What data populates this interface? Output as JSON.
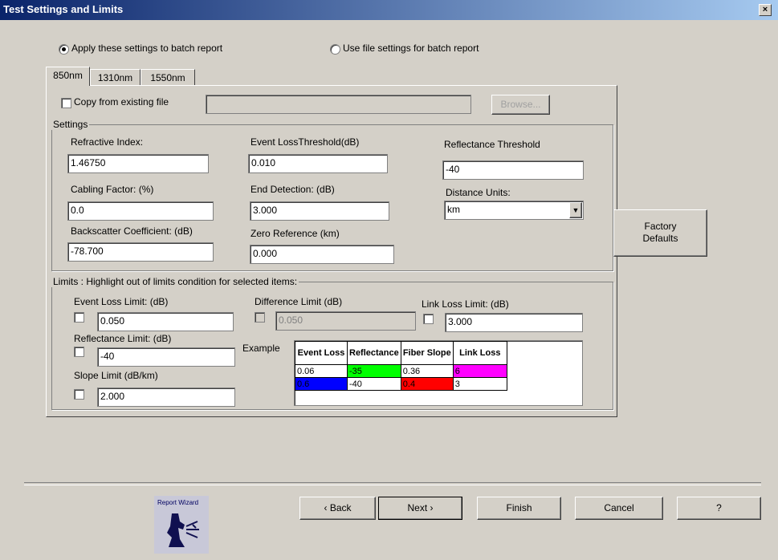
{
  "window": {
    "title": "Test Settings and Limits",
    "close_label": "×"
  },
  "batch": {
    "apply_label": "Apply these settings to batch report",
    "use_file_label": "Use file settings for batch report",
    "selected": "apply"
  },
  "tabs": [
    {
      "label": "850nm"
    },
    {
      "label": "1310nm"
    },
    {
      "label": "1550nm"
    }
  ],
  "copy": {
    "label": "Copy from existing file",
    "path_value": "",
    "browse_label": "Browse..."
  },
  "settings": {
    "group_label": "Settings",
    "refractive_index": {
      "label": "Refractive Index:",
      "value": "1.46750"
    },
    "cabling_factor": {
      "label": "Cabling Factor: (%)",
      "value": "0.0"
    },
    "backscatter": {
      "label": "Backscatter Coefficient: (dB)",
      "value": "-78.700"
    },
    "event_loss_threshold": {
      "label": "Event LossThreshold(dB)",
      "value": "0.010"
    },
    "end_detection": {
      "label": "End Detection: (dB)",
      "value": "3.000"
    },
    "zero_reference": {
      "label": "Zero Reference (km)",
      "value": "0.000"
    },
    "reflectance_threshold": {
      "label": "Reflectance Threshold",
      "value": "-40"
    },
    "distance_units": {
      "label": "Distance Units:",
      "value": "km"
    }
  },
  "factory_defaults": {
    "line1": "Factory",
    "line2": "Defaults"
  },
  "limits": {
    "group_label": "Limits : Highlight out of limits condition for selected items:",
    "event_loss": {
      "label": "Event Loss Limit: (dB)",
      "value": "0.050"
    },
    "reflectance": {
      "label": "Reflectance Limit: (dB)",
      "value": "-40"
    },
    "slope": {
      "label": "Slope Limit (dB/km)",
      "value": "2.000"
    },
    "difference": {
      "label": "Difference Limit (dB)",
      "value": "0.050"
    },
    "link_loss": {
      "label": "Link Loss Limit: (dB)",
      "value": "3.000"
    },
    "example_label": "Example",
    "example_headers": [
      "Event Loss",
      "Reflectance",
      "Fiber Slope",
      "Link Loss"
    ],
    "example_rows": [
      {
        "cells": [
          "0.06",
          "-35",
          "0.36",
          "6"
        ],
        "colors": [
          "#ffffff",
          "#00ff00",
          "#ffffff",
          "#ff00ff"
        ]
      },
      {
        "cells": [
          "0.6",
          "-40",
          "0.4",
          "3"
        ],
        "colors": [
          "#0000ff",
          "#ffffff",
          "#ff0000",
          "#ffffff"
        ]
      }
    ]
  },
  "wizard": {
    "label": "Report Wizard"
  },
  "footer": {
    "back_label": "‹ Back",
    "next_label": "Next ›",
    "finish_label": "Finish",
    "cancel_label": "Cancel",
    "help_label": "?"
  }
}
